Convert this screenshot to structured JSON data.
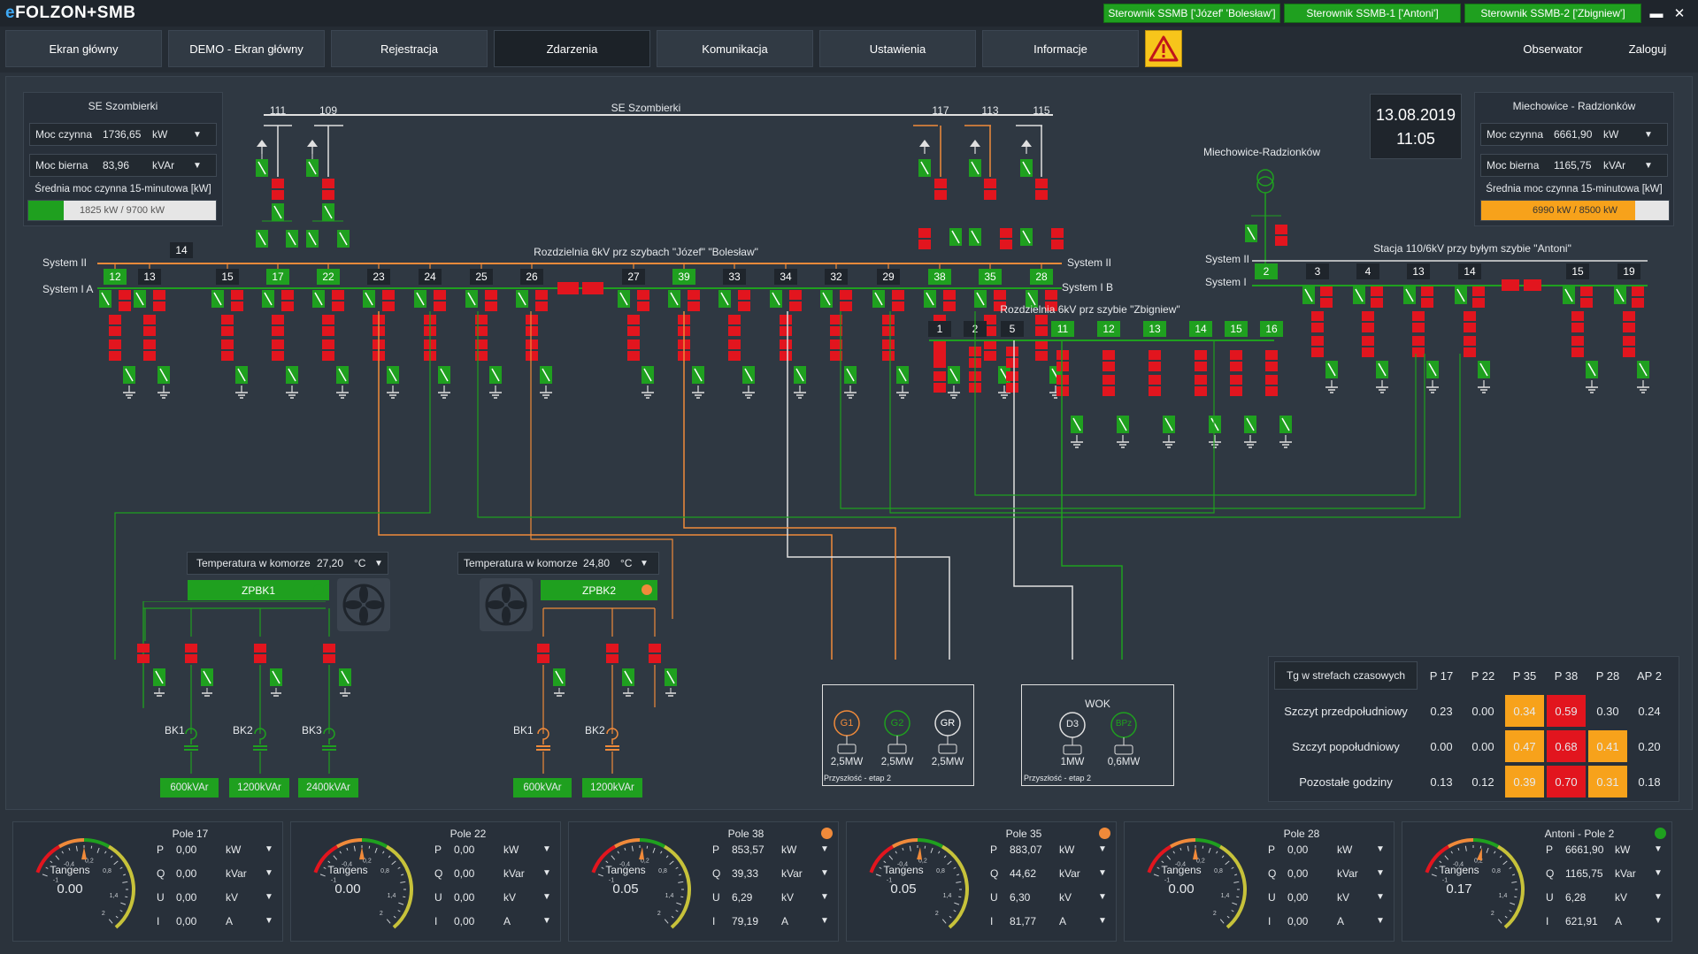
{
  "app": {
    "logo_prefix": "e",
    "logo_name": "FOLZON+SMB"
  },
  "controllers": [
    "Sterownik SSMB ['Józef' 'Bolesław']",
    "Sterownik SSMB-1 ['Antoni']",
    "Sterownik SSMB-2 ['Zbigniew']"
  ],
  "window": {
    "minimize": "▬",
    "close": "✕"
  },
  "nav": {
    "items": [
      "Ekran główny",
      "DEMO - Ekran główny",
      "Rejestracja",
      "Zdarzenia",
      "Komunikacja",
      "Ustawienia",
      "Informacje"
    ],
    "active": "Zdarzenia",
    "alarm_icon": "warning-triangle-icon",
    "observer": "Obserwator",
    "login": "Zaloguj"
  },
  "colors": {
    "green": "#1fa01f",
    "red": "#e2151e",
    "orange": "#f08a3a",
    "white_line": "#e0e0e0",
    "amber": "#f7a21b"
  },
  "left_panel": {
    "title": "SE Szombierki",
    "active_power": {
      "label": "Moc czynna",
      "value": "1736,65",
      "unit": "kW"
    },
    "reactive_power": {
      "label": "Moc bierna",
      "value": "83,96",
      "unit": "kVAr"
    },
    "avg_label": "Średnia moc czynna 15-minutowa [kW]",
    "avg_value": "1825 kW / 9700 kW",
    "avg_fraction": 0.19
  },
  "right_panel": {
    "title": "Miechowice - Radzionków",
    "active_power": {
      "label": "Moc czynna",
      "value": "6661,90",
      "unit": "kW"
    },
    "reactive_power": {
      "label": "Moc bierna",
      "value": "1165,75",
      "unit": "kVAr"
    },
    "avg_label": "Średnia moc czynna 15-minutowa [kW]",
    "avg_value": "6990 kW / 8500 kW",
    "avg_fraction": 0.82
  },
  "datetime": {
    "date": "13.08.2019",
    "time": "11:05"
  },
  "diagram": {
    "se_label": "SE Szombierki",
    "top_feeders": [
      "111",
      "109",
      "117",
      "113",
      "115"
    ],
    "rozdzielnia_label": "Rozdzielnia 6kV prz szybach \"Józef\" \"Bolesław\"",
    "system_ii": "System II",
    "system_ia": "System I A",
    "system_ib": "System I B",
    "system_i": "System I",
    "bays_main": [
      "12",
      "13",
      "14",
      "15",
      "17",
      "22",
      "23",
      "24",
      "25",
      "26",
      "27",
      "39",
      "33",
      "34",
      "32",
      "29",
      "38",
      "35",
      "28"
    ],
    "miechowice_label": "Miechowice-Radzionków",
    "stacja_label": "Stacja 110/6kV przy byłym szybie \"Antoni\"",
    "bays_antoni": [
      "2",
      "3",
      "4",
      "13",
      "14",
      "15",
      "19"
    ],
    "zbigniew_label": "Rozdzielnia 6kV prz szybie \"Zbigniew\"",
    "bays_zbigniew": [
      "1",
      "2",
      "5",
      "11",
      "12",
      "13",
      "14",
      "15",
      "16"
    ]
  },
  "chambers": [
    {
      "temp_label": "Temperatura w komorze",
      "temp_value": "27,20",
      "temp_unit": "°C",
      "name": "ZPBK1",
      "status_color": "#1fa01f",
      "banks": [
        "BK1",
        "BK2",
        "BK3"
      ],
      "caps": [
        "600kVAr",
        "1200kVAr",
        "2400kVAr"
      ]
    },
    {
      "temp_label": "Temperatura w komorze",
      "temp_value": "24,80",
      "temp_unit": "°C",
      "name": "ZPBK2",
      "status_color": "#f08a3a",
      "banks": [
        "BK1",
        "BK2"
      ],
      "caps": [
        "600kVAr",
        "1200kVAr"
      ]
    }
  ],
  "generators": {
    "units": [
      {
        "name": "G1",
        "power": "2,5MW"
      },
      {
        "name": "G2",
        "power": "2,5MW"
      },
      {
        "name": "GR",
        "power": "2,5MW"
      }
    ],
    "note": "Przyszłość - etap 2"
  },
  "wok": {
    "title": "WOK",
    "units": [
      {
        "name": "D3",
        "power": "1MW"
      },
      {
        "name": "BPz",
        "power": "0,6MW"
      }
    ],
    "note": "Przyszłość - etap 2"
  },
  "tg_table": {
    "header": "Tg w strefach czasowych",
    "columns": [
      "P 17",
      "P 22",
      "P 35",
      "P 38",
      "P 28",
      "AP 2"
    ],
    "rows": [
      {
        "label": "Szczyt przedpołudniowy",
        "values": [
          "0.23",
          "0.00",
          "0.34",
          "0.59",
          "0.30",
          "0.24"
        ],
        "colors": [
          "",
          "",
          "#f7a21b",
          "#e2151e",
          "",
          ""
        ]
      },
      {
        "label": "Szczyt popołudniowy",
        "values": [
          "0.00",
          "0.00",
          "0.47",
          "0.68",
          "0.41",
          "0.20"
        ],
        "colors": [
          "",
          "",
          "#f7a21b",
          "#e2151e",
          "#f7a21b",
          ""
        ]
      },
      {
        "label": "Pozostałe godziny",
        "values": [
          "0.13",
          "0.12",
          "0.39",
          "0.70",
          "0.31",
          "0.18"
        ],
        "colors": [
          "",
          "",
          "#f7a21b",
          "#e2151e",
          "#f7a21b",
          ""
        ]
      }
    ]
  },
  "gauges": [
    {
      "title": "Pole 17",
      "status": "",
      "tangens_label": "Tangens",
      "tangens": "0.00",
      "tan_value": 0.0,
      "P": "0,00",
      "P_unit": "kW",
      "Q": "0,00",
      "Q_unit": "kVar",
      "U": "0,00",
      "U_unit": "kV",
      "I": "0,00",
      "I_unit": "A"
    },
    {
      "title": "Pole 22",
      "status": "",
      "tangens_label": "Tangens",
      "tangens": "0.00",
      "tan_value": 0.0,
      "P": "0,00",
      "P_unit": "kW",
      "Q": "0,00",
      "Q_unit": "kVar",
      "U": "0,00",
      "U_unit": "kV",
      "I": "0,00",
      "I_unit": "A"
    },
    {
      "title": "Pole 38",
      "status": "#f08a3a",
      "tangens_label": "Tangens",
      "tangens": "0.05",
      "tan_value": 0.05,
      "P": "853,57",
      "P_unit": "kW",
      "Q": "39,33",
      "Q_unit": "kVar",
      "U": "6,29",
      "U_unit": "kV",
      "I": "79,19",
      "I_unit": "A"
    },
    {
      "title": "Pole 35",
      "status": "#f08a3a",
      "tangens_label": "Tangens",
      "tangens": "0.05",
      "tan_value": 0.05,
      "P": "883,07",
      "P_unit": "kW",
      "Q": "44,62",
      "Q_unit": "kVar",
      "U": "6,30",
      "U_unit": "kV",
      "I": "81,77",
      "I_unit": "A"
    },
    {
      "title": "Pole 28",
      "status": "",
      "tangens_label": "Tangens",
      "tangens": "0.00",
      "tan_value": 0.0,
      "P": "0,00",
      "P_unit": "kW",
      "Q": "0,00",
      "Q_unit": "kVar",
      "U": "0,00",
      "U_unit": "kV",
      "I": "0,00",
      "I_unit": "A"
    },
    {
      "title": "Antoni - Pole 2",
      "status": "#1fa01f",
      "tangens_label": "Tangens",
      "tangens": "0.17",
      "tan_value": 0.17,
      "P": "6661,90",
      "P_unit": "kW",
      "Q": "1165,75",
      "Q_unit": "kVar",
      "U": "6,28",
      "U_unit": "kV",
      "I": "621,91",
      "I_unit": "A"
    }
  ],
  "gauge_scale": [
    "-1",
    "-0,4",
    "0,2",
    "0,8",
    "1,4",
    "2"
  ],
  "gauge_row_labels": [
    "P",
    "Q",
    "U",
    "I"
  ]
}
